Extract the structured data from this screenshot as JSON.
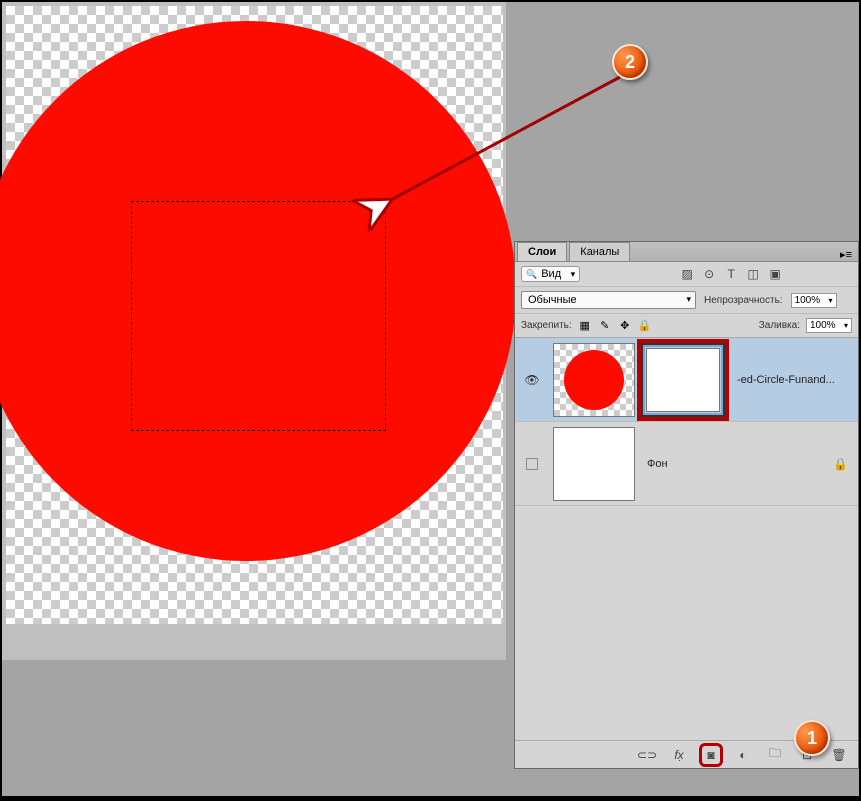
{
  "annotations": {
    "badge1": "1",
    "badge2": "2"
  },
  "panel": {
    "tabs": {
      "layers": "Слои",
      "channels": "Каналы"
    },
    "menu_glyph": "▸≡",
    "filter": {
      "kind": "Вид"
    },
    "icons": {
      "img": "▨",
      "fx": "⊙",
      "type": "T",
      "shape": "◫",
      "smart": "▣"
    },
    "blend": {
      "mode": "Обычные",
      "opacity_label": "Непрозрачность:",
      "opacity": "100%"
    },
    "lock": {
      "label": "Закрепить:",
      "fill_label": "Заливка:",
      "fill": "100%"
    },
    "lock_icons": {
      "trans": "▦",
      "brush": "✎",
      "move": "✥",
      "all": "🔒"
    },
    "layer1": {
      "name": "-ed-Circle-Funand..."
    },
    "layer2": {
      "name": "Фон",
      "lock": "🔒"
    },
    "footer": {
      "link": "⊂⊃",
      "fx": "fx̣",
      "mask": "◙",
      "adjust": "◐",
      "group": "🗀",
      "new": "⊡",
      "trash": "🗑"
    }
  }
}
